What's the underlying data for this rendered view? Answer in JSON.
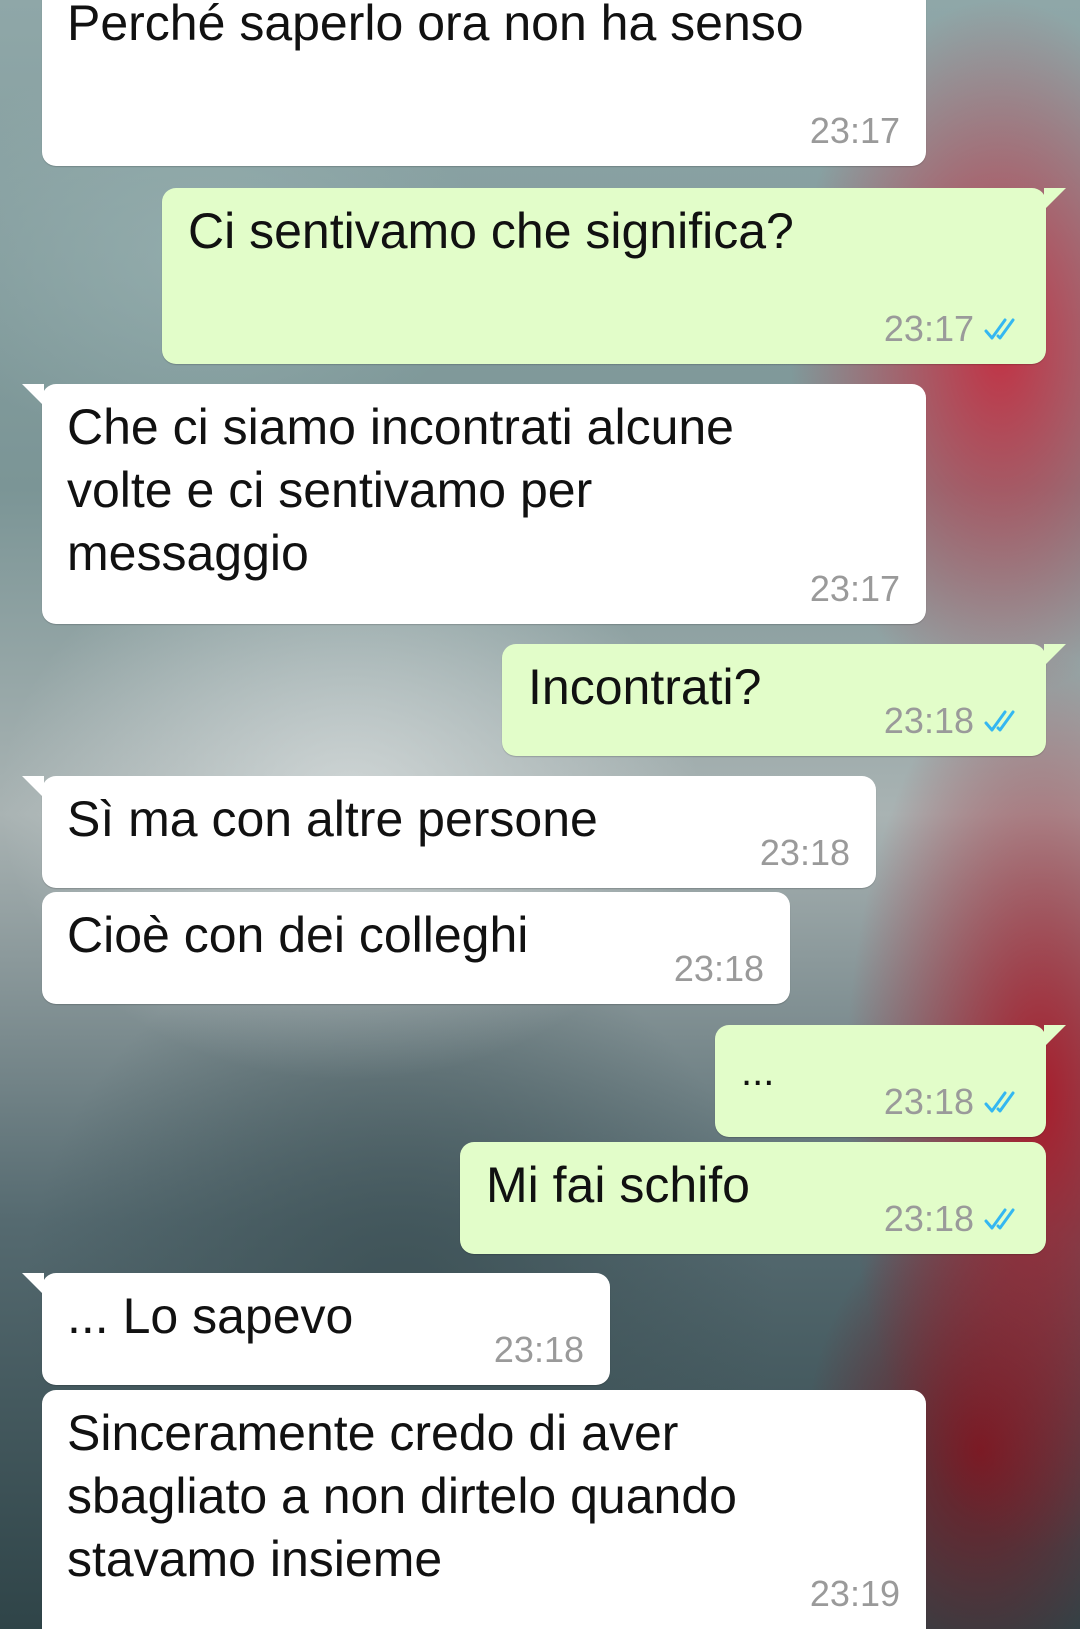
{
  "colors": {
    "incoming_bubble": "#ffffff",
    "outgoing_bubble": "#e2fdc9",
    "timestamp": "#9a9a9a",
    "read_ticks": "#34b7f1"
  },
  "messages": [
    {
      "direction": "in",
      "text": "Perché saperlo ora non ha senso",
      "time": "23:17"
    },
    {
      "direction": "out",
      "text": "Ci sentivamo che significa?",
      "time": "23:17",
      "status": "read"
    },
    {
      "direction": "in",
      "text": "Che ci siamo incontrati alcune\nvolte e ci sentivamo per\nmessaggio",
      "time": "23:17"
    },
    {
      "direction": "out",
      "text": "Incontrati?",
      "time": "23:18",
      "status": "read"
    },
    {
      "direction": "in",
      "text": "Sì ma con altre persone",
      "time": "23:18"
    },
    {
      "direction": "in",
      "text": "Cioè con dei colleghi",
      "time": "23:18"
    },
    {
      "direction": "out",
      "text": "...",
      "time": "23:18",
      "status": "read"
    },
    {
      "direction": "out",
      "text": "Mi fai schifo",
      "time": "23:18",
      "status": "read"
    },
    {
      "direction": "in",
      "text": "... Lo sapevo",
      "time": "23:18"
    },
    {
      "direction": "in",
      "text": "Sinceramente credo di aver\nsbagliato a non dirtelo quando\nstavamo insieme",
      "time": "23:19"
    }
  ]
}
